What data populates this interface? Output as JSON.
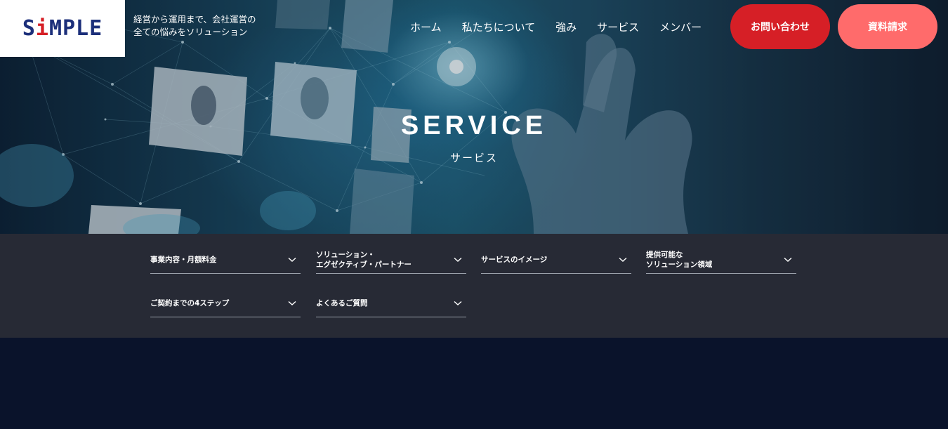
{
  "header": {
    "logo_prefix": "S",
    "logo_i": "i",
    "logo_suffix": "MPLE",
    "tagline_line1": "経営から運用まで、会社運営の",
    "tagline_line2": "全ての悩みをソリューション",
    "nav": [
      "ホーム",
      "私たちについて",
      "強み",
      "サービス",
      "メンバー"
    ],
    "contact_button": "お問い合わせ",
    "docs_button": "資料請求"
  },
  "hero": {
    "title": "SERVICE",
    "subtitle": "サービス"
  },
  "subnav": {
    "items": [
      {
        "label": "事業内容・月額料金",
        "icon": "chevron-down-icon"
      },
      {
        "label": "ソリューション・\nエグゼクティブ・パートナー",
        "icon": "chevron-down-icon"
      },
      {
        "label": "サービスのイメージ",
        "icon": "chevron-down-icon"
      },
      {
        "label": "提供可能な\nソリューション領域",
        "icon": "chevron-down-icon"
      },
      {
        "label": "ご契約までの4ステップ",
        "icon": "chevron-down-icon"
      },
      {
        "label": "よくあるご質問",
        "icon": "chevron-down-icon"
      }
    ]
  },
  "colors": {
    "brand_navy": "#1c2f7a",
    "brand_red": "#d61f26",
    "docs_coral": "#ff6b6b",
    "subnav_bg": "#272a35",
    "page_bg": "#0a132b"
  }
}
